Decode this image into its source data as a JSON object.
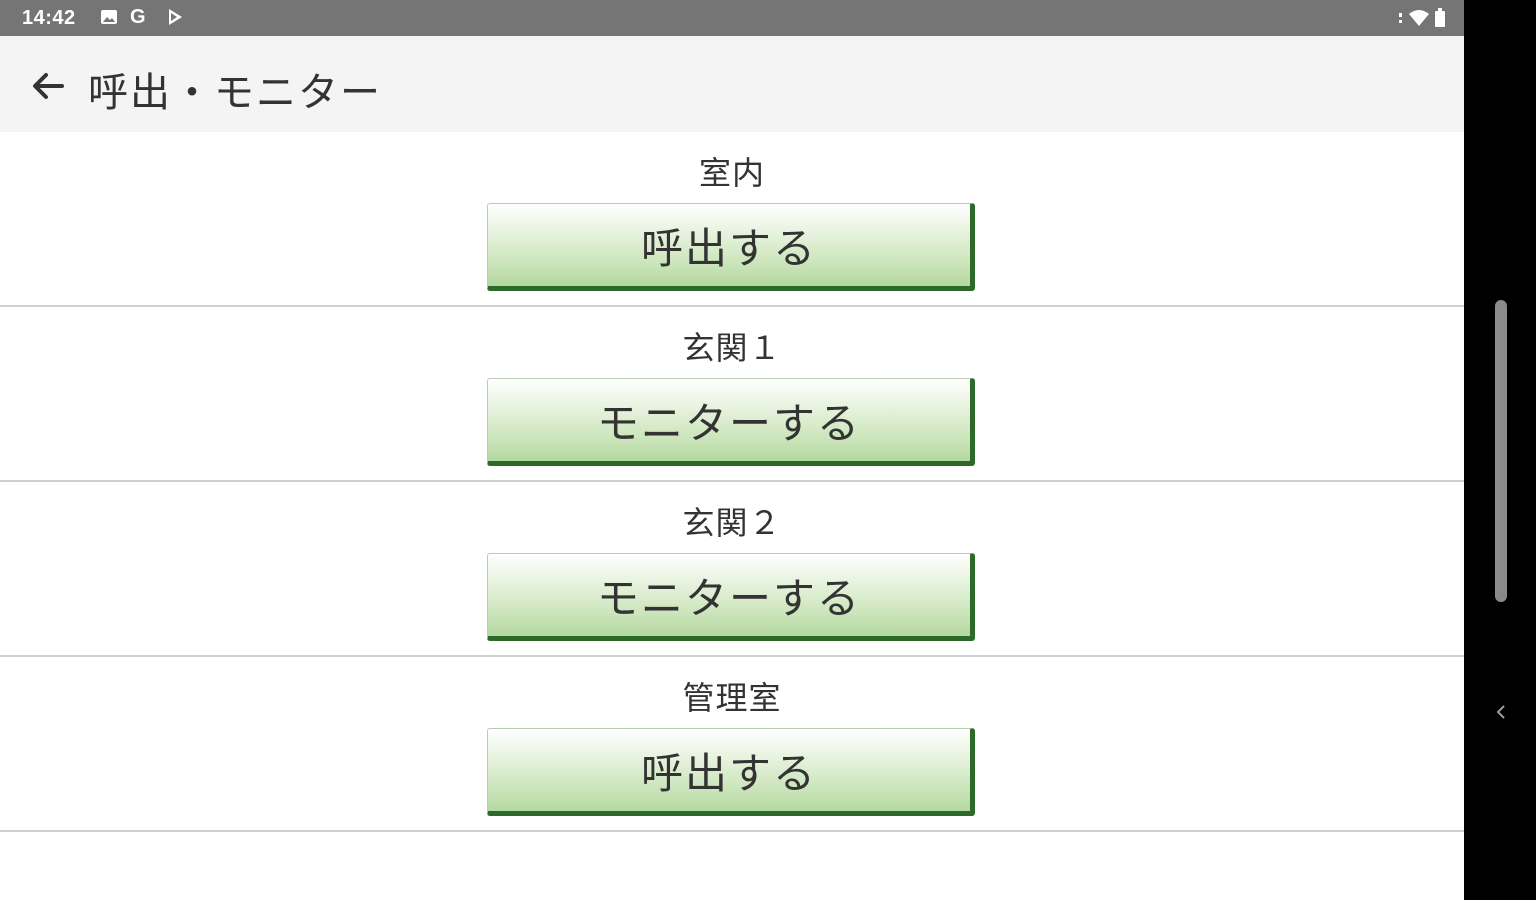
{
  "status_bar": {
    "time": "14:42",
    "left_icons": [
      "image-icon",
      "google-icon",
      "play-store-icon"
    ],
    "right_icons": [
      "signal-icon",
      "wifi-icon",
      "battery-icon"
    ]
  },
  "app_bar": {
    "title": "呼出・モニター",
    "back_icon": "arrow-left-icon"
  },
  "rows": [
    {
      "label": "室内",
      "button": "呼出する"
    },
    {
      "label": "玄関１",
      "button": "モニターする"
    },
    {
      "label": "玄関２",
      "button": "モニターする"
    },
    {
      "label": "管理室",
      "button": "呼出する"
    }
  ],
  "colors": {
    "status_bar": "#757575",
    "app_bar": "#f4f4f4",
    "button_gradient_top": "#ffffff",
    "button_gradient_bottom": "#b4d8a0",
    "button_shadow": "#2d6a2a",
    "divider": "#cfcfcf"
  },
  "nav_bar": {
    "chevron_icon": "chevron-left-icon"
  }
}
